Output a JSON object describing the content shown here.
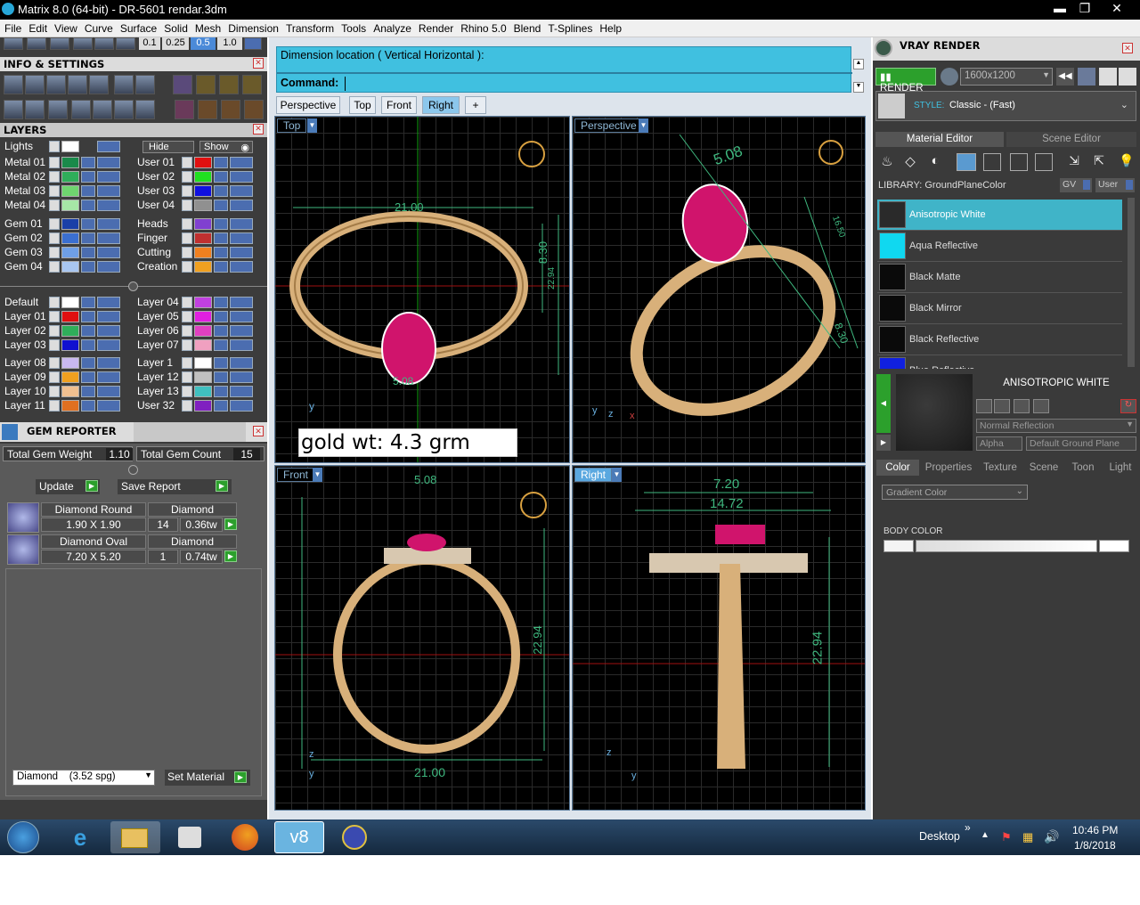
{
  "window": {
    "title": "Matrix 8.0 (64-bit) - DR-5601 rendar.3dm",
    "minimize": "▬",
    "restore": "❐",
    "close": "✕"
  },
  "menu": [
    "File",
    "Edit",
    "View",
    "Curve",
    "Surface",
    "Solid",
    "Mesh",
    "Dimension",
    "Transform",
    "Tools",
    "Analyze",
    "Render",
    "Rhino 5.0",
    "Blend",
    "T-Splines",
    "Help"
  ],
  "zoom_steps": [
    "0.1",
    "0.25",
    "0.5",
    "1.0"
  ],
  "info_panel": {
    "title": "INFO & SETTINGS"
  },
  "layers_panel": {
    "title": "LAYERS",
    "lights_label": "Lights",
    "hide_label": "Hide",
    "show_label": "Show"
  },
  "layers_left": [
    {
      "name": "Metal 01",
      "color": "#1a8a4a"
    },
    {
      "name": "Metal 02",
      "color": "#2fae5a"
    },
    {
      "name": "Metal 03",
      "color": "#6fd46f"
    },
    {
      "name": "Metal 04",
      "color": "#a6e6a6"
    },
    {
      "name": "Gem 01",
      "color": "#1a3fa8"
    },
    {
      "name": "Gem 02",
      "color": "#3b6fd0"
    },
    {
      "name": "Gem 03",
      "color": "#6f9fe6"
    },
    {
      "name": "Gem 04",
      "color": "#a9c6f0"
    },
    {
      "name": "Default",
      "color": "#ffffff"
    },
    {
      "name": "Layer 01",
      "color": "#e01010"
    },
    {
      "name": "Layer 02",
      "color": "#2fae5a"
    },
    {
      "name": "Layer 03",
      "color": "#1010d0"
    },
    {
      "name": "Layer 08",
      "color": "#c9b8f0"
    },
    {
      "name": "Layer 09",
      "color": "#f0a020"
    },
    {
      "name": "Layer 10",
      "color": "#f0c090"
    },
    {
      "name": "Layer 11",
      "color": "#e07020"
    }
  ],
  "layers_right": [
    {
      "name": "User 01",
      "color": "#e01010"
    },
    {
      "name": "User 02",
      "color": "#20e020"
    },
    {
      "name": "User 03",
      "color": "#1010e0"
    },
    {
      "name": "User 04",
      "color": "#909090"
    },
    {
      "name": "Heads",
      "color": "#8040d0"
    },
    {
      "name": "Finger",
      "color": "#c03030"
    },
    {
      "name": "Cutting",
      "color": "#f08020"
    },
    {
      "name": "Creation",
      "color": "#f0a020"
    },
    {
      "name": "Layer 04",
      "color": "#c040e0"
    },
    {
      "name": "Layer 05",
      "color": "#e020e0"
    },
    {
      "name": "Layer 06",
      "color": "#e040c0"
    },
    {
      "name": "Layer 07",
      "color": "#f0a0c0"
    },
    {
      "name": "Layer 1",
      "color": "#ffffff"
    },
    {
      "name": "Layer 12",
      "color": "#c0c0c0"
    },
    {
      "name": "Layer 13",
      "color": "#40c0c0"
    },
    {
      "name": "User 32",
      "color": "#8020c0"
    }
  ],
  "gem_reporter": {
    "title": "GEM REPORTER",
    "total_weight_label": "Total Gem Weight",
    "total_weight": "1.10",
    "total_count_label": "Total Gem Count",
    "total_count": "15",
    "update_label": "Update",
    "save_label": "Save Report",
    "gems": [
      {
        "shape": "Diamond Round",
        "size": "1.90 X 1.90",
        "material": "Diamond",
        "count": "14",
        "weight": "0.36tw"
      },
      {
        "shape": "Diamond Oval",
        "size": "7.20 X 5.20",
        "material": "Diamond",
        "count": "1",
        "weight": "0.74tw"
      }
    ],
    "material_select": "Diamond    (3.52 spg)",
    "set_material_label": "Set Material"
  },
  "command": {
    "prompt_line": "Dimension location ( Vertical  Horizontal ):",
    "command_label": "Command:"
  },
  "view_tabs": [
    "Perspective",
    "Top",
    "Front",
    "Right",
    "+"
  ],
  "viewports": {
    "top": {
      "label": "Top",
      "dims": [
        "21.00",
        "8.30",
        "22.94",
        "5.08"
      ]
    },
    "perspective": {
      "label": "Perspective",
      "dims": [
        "5.08",
        "16.50",
        "8.30"
      ]
    },
    "front": {
      "label": "Front",
      "dims": [
        "5.08",
        "22.94",
        "21.00"
      ]
    },
    "right": {
      "label": "Right",
      "dims": [
        "7.20",
        "14.72",
        "22.94"
      ]
    }
  },
  "axis_labels": {
    "y": "y",
    "z": "z",
    "x": "x"
  },
  "gold_note": "gold wt: 4.3 grm",
  "vray": {
    "title": "VRAY RENDER",
    "render_label": "RENDER",
    "resolution": "1600x1200",
    "style_label": "STYLE:",
    "style_value": "Classic - (Fast)",
    "tab_material": "Material Editor",
    "tab_scene": "Scene Editor",
    "library_label": "LIBRARY: GroundPlaneColor",
    "gv_label": "GV",
    "user_label": "User",
    "materials": [
      {
        "name": "Anisotropic White",
        "color": "#2a2a2a"
      },
      {
        "name": "Aqua Reflective",
        "color": "#10d8f0"
      },
      {
        "name": "Black Matte",
        "color": "#0a0a0a"
      },
      {
        "name": "Black Mirror",
        "color": "#0a0a0a"
      },
      {
        "name": "Black Reflective",
        "color": "#0a0a0a"
      },
      {
        "name": "Blue Reflective",
        "color": "#1020e0"
      }
    ],
    "selected_material": "ANISOTROPIC WHITE",
    "reflection_select": "Normal Reflection",
    "alpha_label": "Alpha",
    "ground_plane_label": "Default Ground Plane",
    "prop_tabs": [
      "Color",
      "Properties",
      "Texture",
      "Scene",
      "Toon",
      "Light"
    ],
    "gradient_select": "Gradient Color",
    "body_color_label": "BODY COLOR"
  },
  "taskbar": {
    "desktop_label": "Desktop",
    "time": "10:46 PM",
    "date": "1/8/2018",
    "overflow": "»"
  }
}
